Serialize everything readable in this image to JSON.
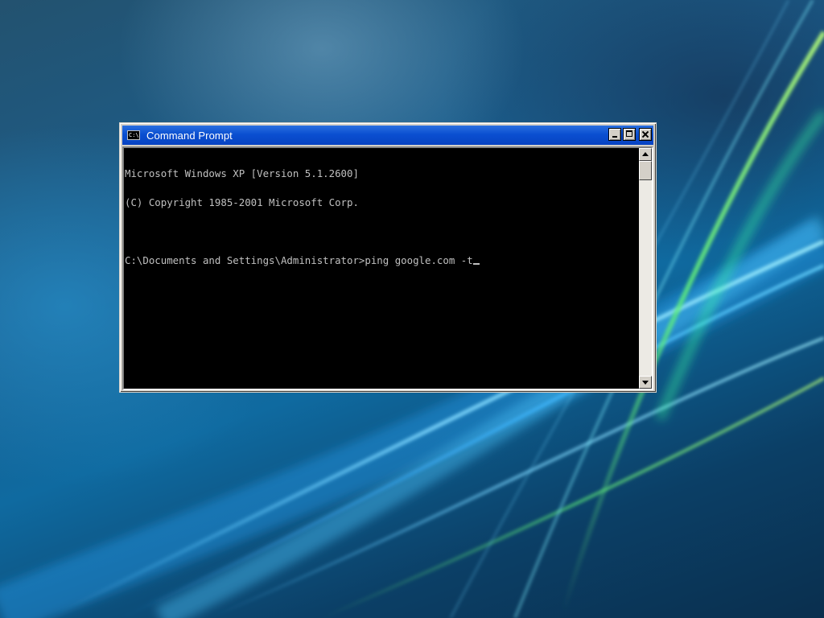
{
  "window": {
    "title": "Command Prompt",
    "icon": "console-icon",
    "icon_glyph": "C:\\",
    "buttons": {
      "minimize": "minimize-icon",
      "maximize": "maximize-icon",
      "close": "close-icon"
    }
  },
  "console": {
    "lines": [
      "Microsoft Windows XP [Version 5.1.2600]",
      "(C) Copyright 1985-2001 Microsoft Corp.",
      "",
      "C:\\Documents and Settings\\Administrator>ping google.com -t"
    ],
    "text_color": "#c0c0c0",
    "background": "#000000"
  },
  "colors": {
    "titlebar": "#0a4fd1",
    "window_face": "#d4d0c8"
  }
}
